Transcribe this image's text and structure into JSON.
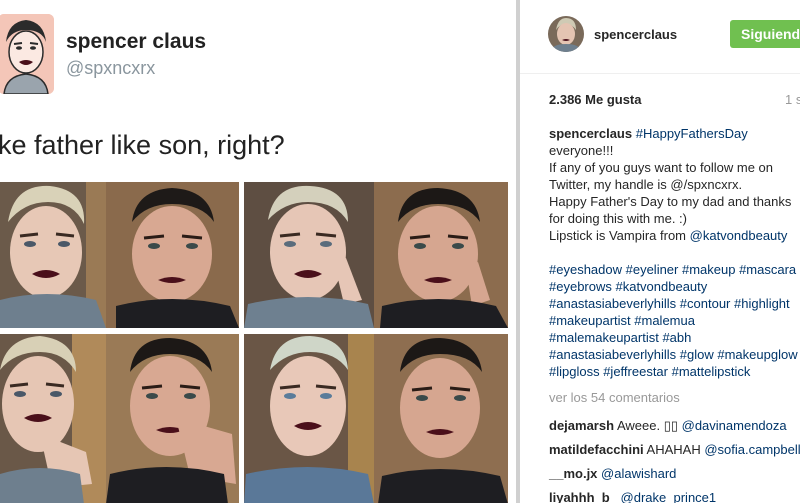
{
  "tweet": {
    "name": "spencer claus",
    "handle": "@spxncxrx",
    "text": "ke father like son, right?"
  },
  "instagram": {
    "username": "spencerclaus",
    "follow_label": "Siguiendo",
    "likes": "2.386 Me gusta",
    "time": "1 s",
    "caption": {
      "author": "spencerclaus",
      "hashtag_intro": "#HappyFathersDay",
      "lines": [
        "everyone!!!",
        "If any of you guys want to follow me on",
        "Twitter, my handle is @/spxncxrx.",
        "Happy Father's Day to my dad and thanks",
        "for doing this with me. :)"
      ],
      "lipstick_text": "Lipstick is Vampira from ",
      "lipstick_mention": "@katvondbeauty",
      "hashtag_lines": [
        "#eyeshadow #eyeliner #makeup #mascara",
        "#eyebrows #katvondbeauty",
        "#anastasiabeverlyhills #contour #highlight",
        "#makeupartist #malemua",
        "#malemakeupartist #abh",
        "#anastasiabeverlyhills #glow #makeupglow",
        "#lipgloss #jeffreestar #mattelipstick"
      ]
    },
    "view_comments": "ver los 54 comentarios",
    "comments": [
      {
        "user": "dejamarsh",
        "text": "Aweee. ▯▯ ",
        "mention": "@davinamendoza"
      },
      {
        "user": "matildefacchini",
        "text": "AHAHAH ",
        "mention": "@sofia.campbell"
      },
      {
        "user": "__mo.jx",
        "text": "",
        "mention": "@alawishard"
      },
      {
        "user": "liyahhh_b_",
        "text": "",
        "mention": "@drake_prince1"
      }
    ]
  },
  "colors": {
    "follow_green": "#70c050",
    "link_blue": "#003569",
    "lipstick": "#4a0f1a"
  }
}
